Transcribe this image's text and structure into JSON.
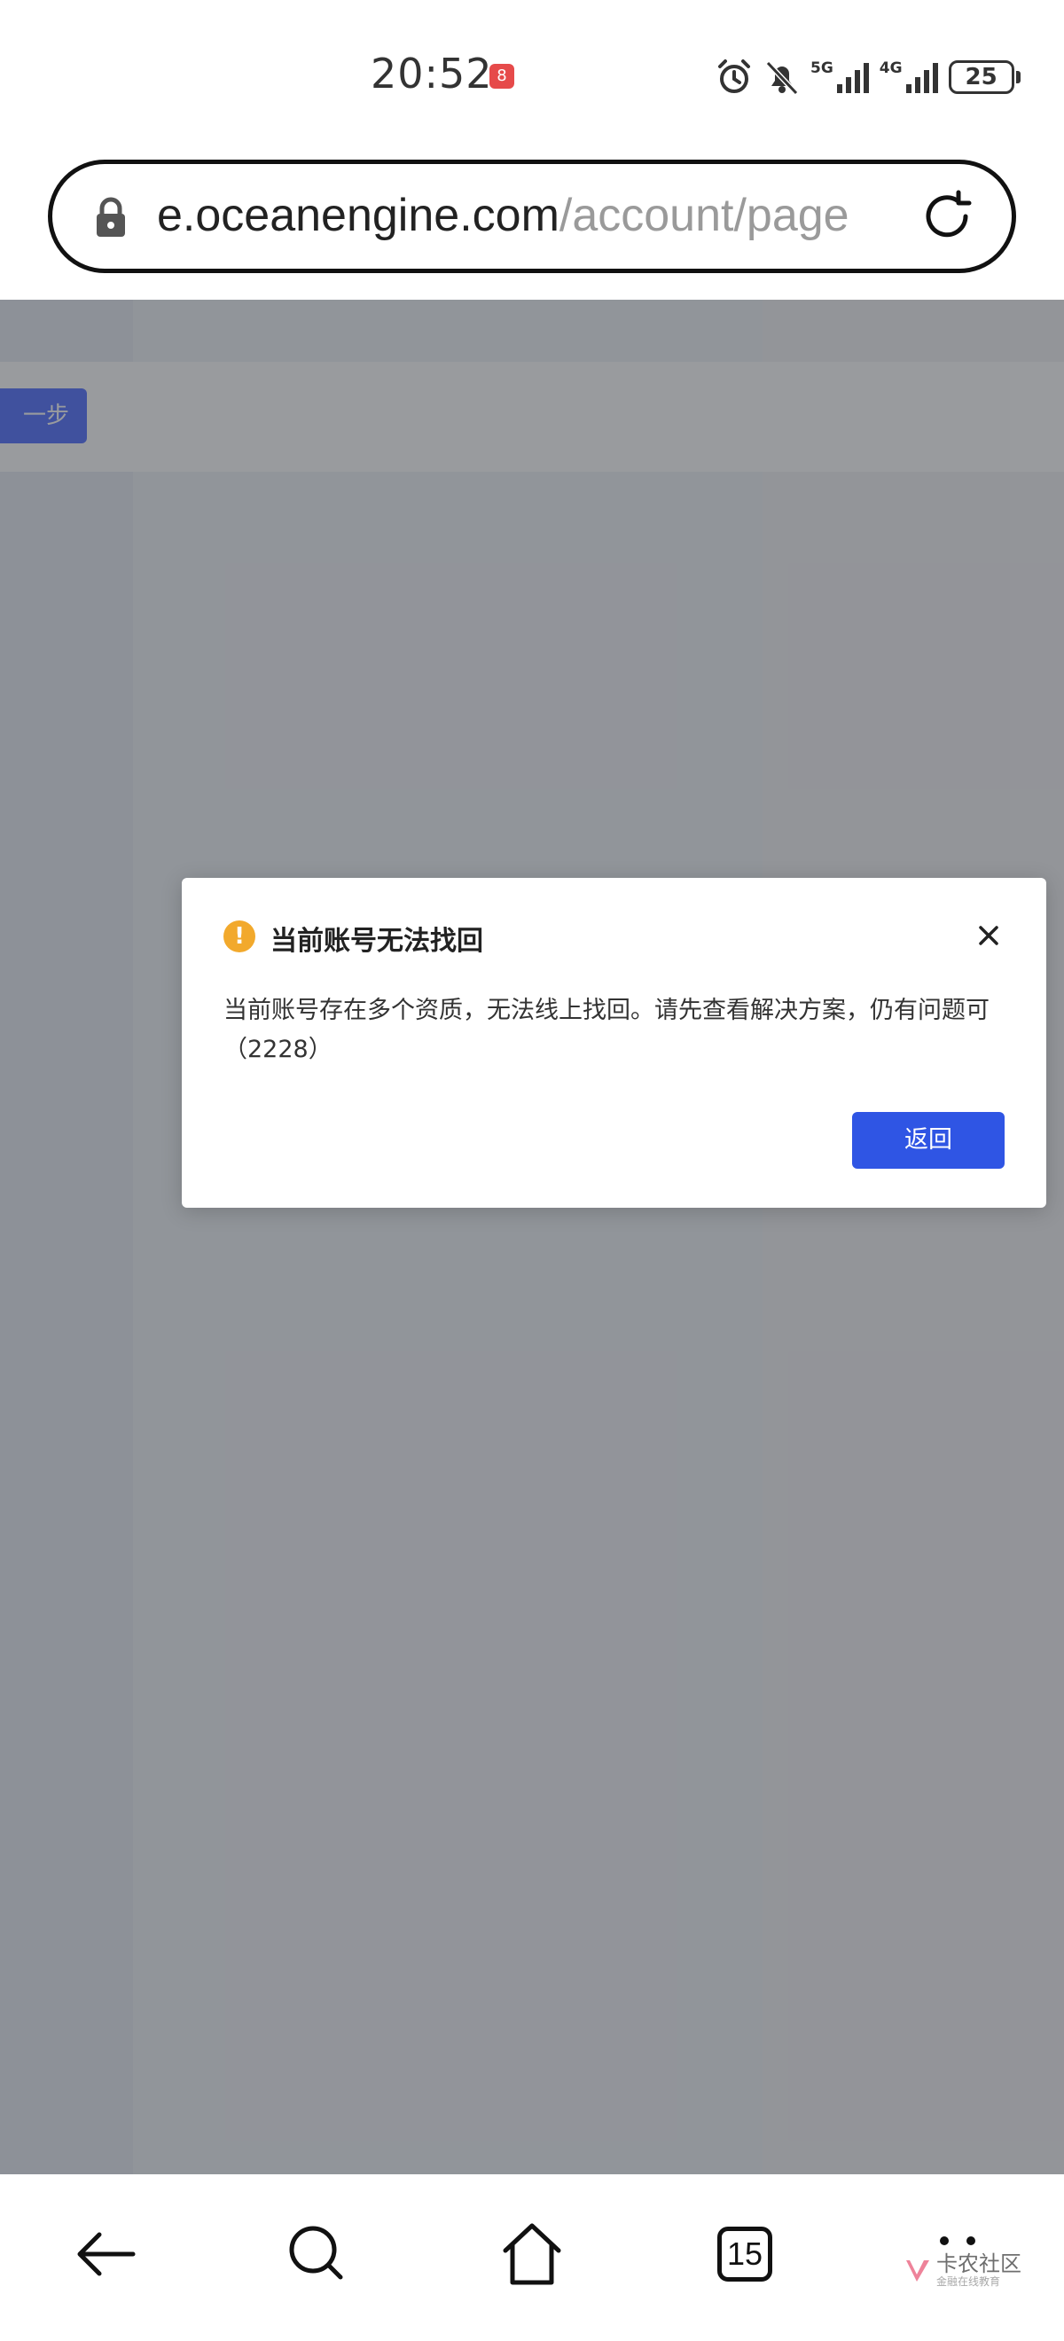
{
  "status_bar": {
    "time": "20:52",
    "app_badge": "8",
    "network_1": "5G",
    "network_2": "4G",
    "battery": "25"
  },
  "browser": {
    "url_host": "e.oceanengine.com",
    "url_path": "/account/page"
  },
  "page": {
    "prev_button_label": "一步"
  },
  "dialog": {
    "warning_glyph": "!",
    "title": "当前账号无法找回",
    "message": "当前账号存在多个资质，无法线上找回。请先查看解决方案，仍有问题可（2228）",
    "back_button_label": "返回"
  },
  "bottom_nav": {
    "tab_count": "15"
  },
  "watermark": {
    "title": "卡农社区",
    "subtitle": "金融在线教育"
  },
  "colors": {
    "primary_button": "#2f55e4",
    "warning": "#f2a92c",
    "overlay": "rgba(70,72,78,0.55)"
  }
}
